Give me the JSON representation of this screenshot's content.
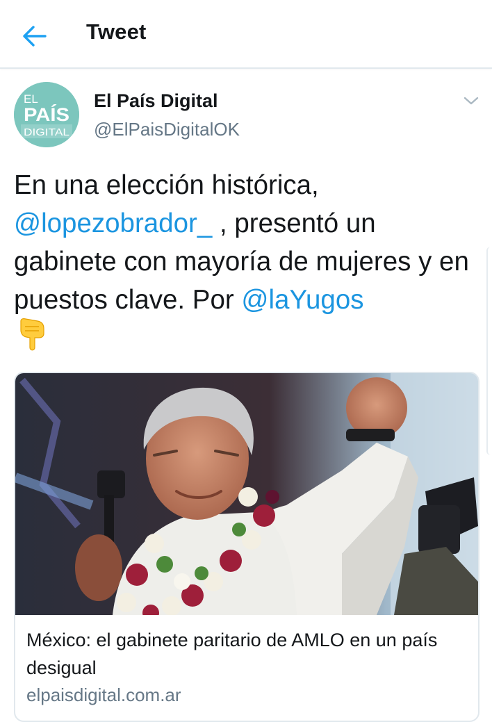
{
  "header": {
    "title": "Tweet",
    "back_icon": "arrow-left-icon",
    "accent_color": "#1da1f2"
  },
  "tweet": {
    "account": {
      "name": "El País Digital",
      "handle": "@ElPaisDigitalOK",
      "avatar": {
        "line1": "EL",
        "line2": "PAÍS",
        "line3": "DIGITAL",
        "color": "#7cc6bd"
      }
    },
    "menu_icon": "chevron-down-icon",
    "text": {
      "part1": "En una elección histórica, ",
      "mention1": "@lopezobrador_",
      "part2": " , presentó un gabinete con mayoría de mujeres y en puestos clave. Por ",
      "mention2": "@laYugos"
    },
    "emoji": "backhand-index-pointing-down",
    "link_color": "#1b95e0",
    "card": {
      "title": "México: el gabinete paritario de AMLO en un país desigual",
      "domain": "elpaisdigital.com.ar"
    }
  }
}
